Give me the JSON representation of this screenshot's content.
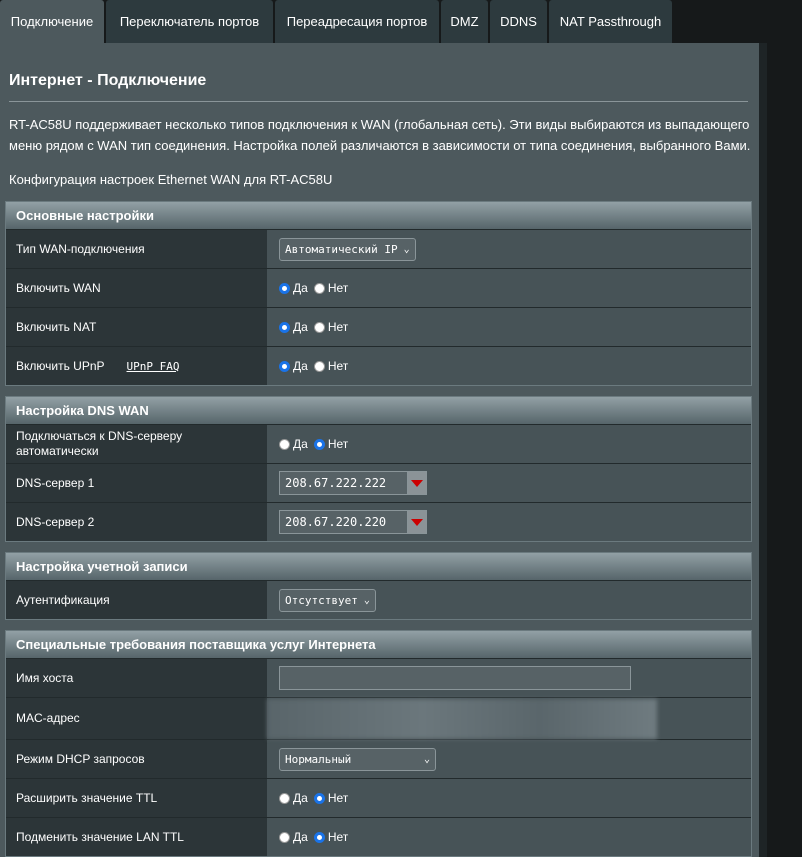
{
  "tabs": [
    "Подключение",
    "Переключатель портов",
    "Переадресация портов",
    "DMZ",
    "DDNS",
    "NAT Passthrough"
  ],
  "page": {
    "title": "Интернет - Подключение",
    "description": "RT-AC58U поддерживает несколько типов подключения к WAN (глобальная сеть). Эти виды выбираются из выпадающего меню рядом с WAN тип соединения. Настройка полей различаются в зависимости от типа соединения, выбранного Вами.",
    "config_note": "Конфигурация настроек Ethernet WAN для RT-AC58U"
  },
  "basic": {
    "header": "Основные настройки",
    "wan_type_label": "Тип WAN-подключения",
    "wan_type_value": "Автоматический IP",
    "enable_wan_label": "Включить WAN",
    "enable_nat_label": "Включить NAT",
    "enable_upnp_label": "Включить UPnP",
    "upnp_faq": "UPnP FAQ"
  },
  "dns": {
    "header": "Настройка DNS WAN",
    "auto_label": "Подключаться к DNS-серверу автоматически",
    "dns1_label": "DNS-сервер 1",
    "dns1_value": "208.67.222.222",
    "dns2_label": "DNS-сервер 2",
    "dns2_value": "208.67.220.220"
  },
  "account": {
    "header": "Настройка учетной записи",
    "auth_label": "Аутентификация",
    "auth_value": "Отсутствует"
  },
  "isp": {
    "header": "Специальные требования поставщика услуг Интернета",
    "hostname_label": "Имя хоста",
    "hostname_value": "",
    "mac_label": "MAC-адрес",
    "dhcp_label": "Режим DHCP запросов",
    "dhcp_value": "Нормальный",
    "ttl_label": "Расширить значение TTL",
    "lan_ttl_label": "Подменить значение LAN TTL"
  },
  "radio": {
    "yes": "Да",
    "no": "Нет"
  },
  "colors": {
    "accent": "#1a73e8",
    "panel": "#4d595d"
  }
}
